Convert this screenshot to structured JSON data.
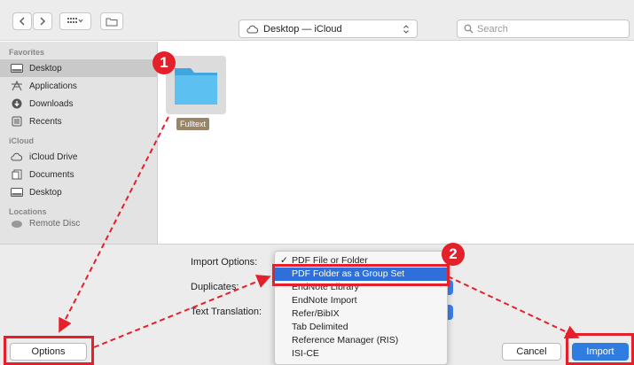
{
  "toolbar": {
    "view_icon_name": "grid-view-icon",
    "location_label": "Desktop — iCloud",
    "search_placeholder": "Search"
  },
  "sidebar": {
    "favorites_label": "Favorites",
    "favorites": [
      {
        "label": "Desktop",
        "icon": "desktop-icon",
        "selected": true
      },
      {
        "label": "Applications",
        "icon": "applications-icon",
        "selected": false
      },
      {
        "label": "Downloads",
        "icon": "downloads-icon",
        "selected": false
      },
      {
        "label": "Recents",
        "icon": "recents-icon",
        "selected": false
      }
    ],
    "icloud_label": "iCloud",
    "icloud": [
      {
        "label": "iCloud Drive",
        "icon": "cloud-icon"
      },
      {
        "label": "Documents",
        "icon": "documents-icon"
      },
      {
        "label": "Desktop",
        "icon": "desktop-icon"
      }
    ],
    "locations_label": "Locations",
    "locations": [
      {
        "label": "Remote Disc",
        "icon": "disc-icon"
      }
    ]
  },
  "content": {
    "folder_name": "Fulltext"
  },
  "options": {
    "import_options_label": "Import Options:",
    "duplicates_label": "Duplicates:",
    "text_translation_label": "Text Translation:",
    "dropdown_items": [
      {
        "label": "PDF File or Folder",
        "checked": true,
        "highlighted": false
      },
      {
        "label": "PDF Folder as a Group Set",
        "checked": false,
        "highlighted": true
      },
      {
        "label": "EndNote Library",
        "checked": false,
        "highlighted": false
      },
      {
        "label": "EndNote Import",
        "checked": false,
        "highlighted": false
      },
      {
        "label": "Refer/BibIX",
        "checked": false,
        "highlighted": false
      },
      {
        "label": "Tab Delimited",
        "checked": false,
        "highlighted": false
      },
      {
        "label": "Reference Manager (RIS)",
        "checked": false,
        "highlighted": false
      },
      {
        "label": "ISI-CE",
        "checked": false,
        "highlighted": false
      }
    ]
  },
  "buttons": {
    "options": "Options",
    "cancel": "Cancel",
    "import": "Import"
  },
  "annotations": {
    "step1": "1",
    "step2": "2",
    "color": "#e4202b"
  },
  "colors": {
    "accent": "#2f7de1",
    "folder": "#4fb6ec",
    "highlight": "#2e6fd9"
  }
}
